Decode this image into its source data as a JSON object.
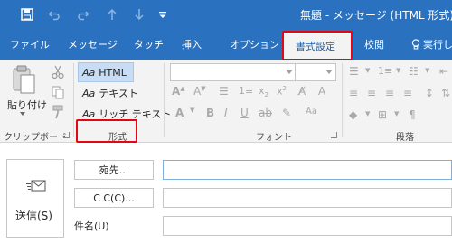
{
  "window": {
    "title": "無題 - メッセージ (HTML 形式)"
  },
  "quick_access": [
    {
      "icon": "save-icon"
    },
    {
      "icon": "undo-icon"
    },
    {
      "icon": "redo-icon"
    },
    {
      "icon": "up-arrow-icon"
    },
    {
      "icon": "down-arrow-icon"
    },
    {
      "icon": "customize-qat-icon"
    }
  ],
  "tabs": {
    "file": "ファイル",
    "message": "メッセージ",
    "touch": "タッチ",
    "insert": "挿入",
    "options": "オプション",
    "format_text": "書式設定",
    "review": "校閲",
    "tell_me": "実行し"
  },
  "ribbon": {
    "clipboard": {
      "paste_label": "貼り付け",
      "group_label": "クリップボード"
    },
    "format": {
      "html_aa": "Aa",
      "html_label": "HTML",
      "text_aa": "Aa",
      "text_label": "テキスト",
      "rich_aa": "Aa",
      "rich_label": "リッチ テキスト",
      "group_label": "形式",
      "selected": "HTML"
    },
    "font": {
      "group_label": "フォント"
    },
    "paragraph": {
      "group_label": "段落"
    }
  },
  "compose": {
    "send_label": "送信(S)",
    "to_label": "宛先...",
    "cc_label": "C C(C)...",
    "subject_label": "件名(U)"
  },
  "colors": {
    "titlebar": "#2a72c0",
    "ribbon_bg": "#f3f3f3",
    "highlight_red": "#e30613",
    "selected_blue": "#c8ddf4"
  }
}
